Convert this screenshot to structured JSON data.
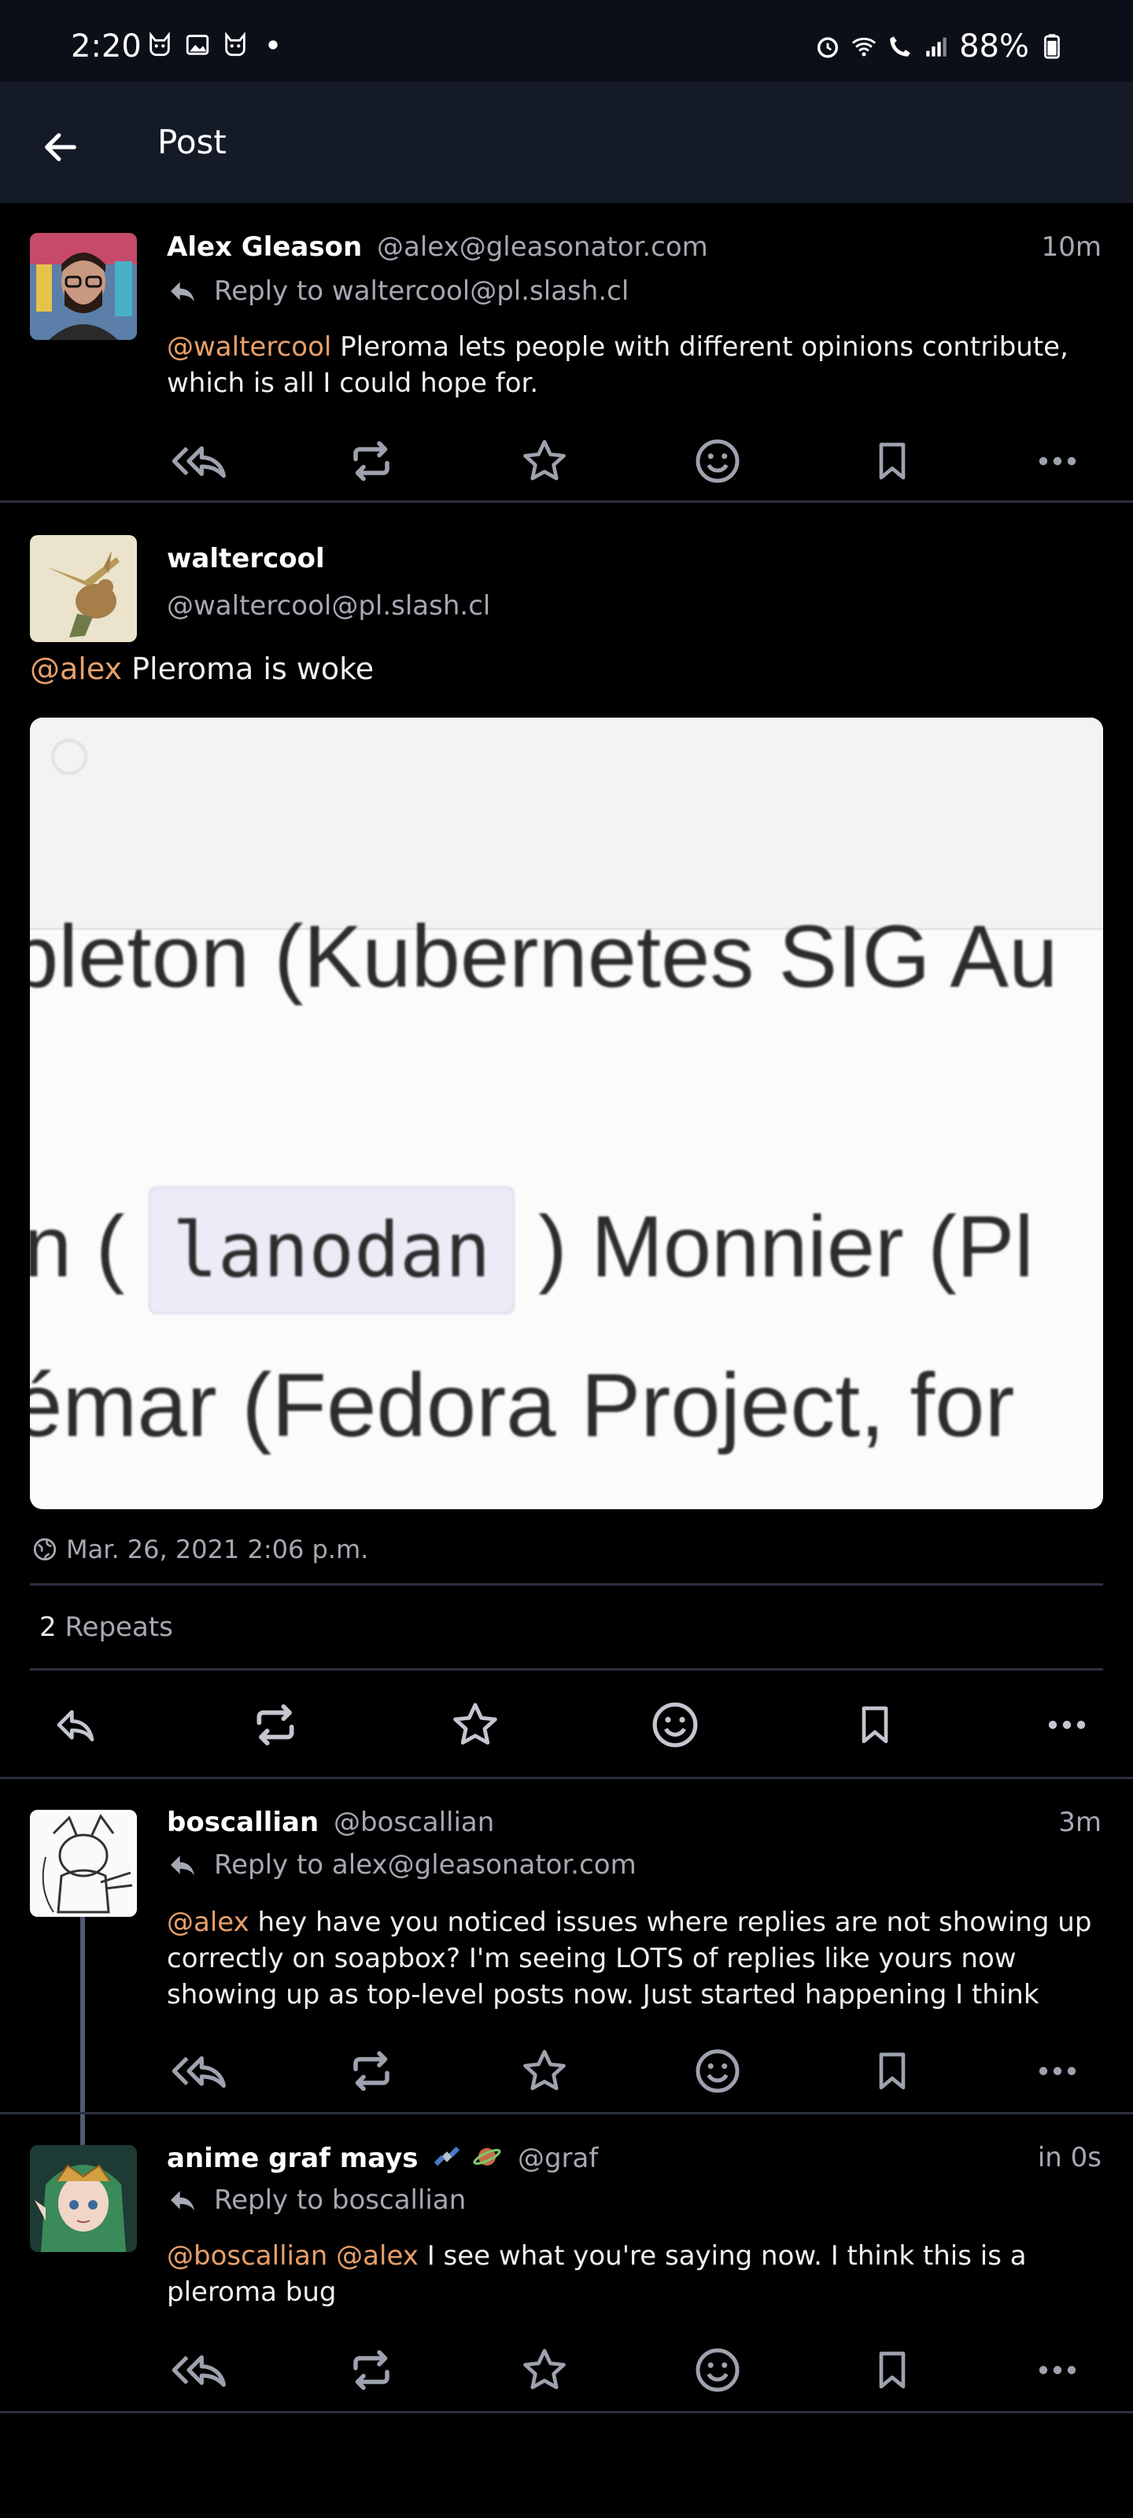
{
  "status_bar": {
    "time": "2:20",
    "battery": "88%"
  },
  "app_bar": {
    "title": "Post"
  },
  "post1": {
    "display_name": "Alex Gleason",
    "handle": "@alex@gleasonator.com",
    "time": "10m",
    "reply_to": "Reply to waltercool@pl.slash.cl",
    "mention": "@waltercool",
    "text": " Pleroma lets people with different opinions contribute, which is all I could hope for."
  },
  "main_post": {
    "display_name": "waltercool",
    "handle": "@waltercool@pl.slash.cl",
    "mention": "@alex",
    "text": " Pleroma is woke",
    "image_text": {
      "line1": "pleton (Kubernetes SIG Au",
      "line2_prefix": "n (",
      "line2_code": "lanodan",
      "line2_suffix": ") Monnier (Pl",
      "line3": "émar (Fedora Project, for"
    },
    "date": "Mar. 26, 2021 2:06 p.m.",
    "repeats_count": "2",
    "repeats_label": "Repeats"
  },
  "post3": {
    "display_name": "boscallian",
    "handle": "@boscallian",
    "time": "3m",
    "reply_to": "Reply to alex@gleasonator.com",
    "mention": "@alex",
    "text": " hey have you noticed issues where replies are not showing up correctly on soapbox? I'm seeing LOTS of replies like yours now showing up as top-level posts now. Just started happening I think"
  },
  "post4": {
    "display_name": "anime graf mays",
    "handle": "@graf",
    "time": "in 0s",
    "reply_to": "Reply to boscallian",
    "mention": "@boscallian @alex",
    "text": " I see what you're saying now. I think this is a pleroma bug"
  },
  "icons": {
    "reply": "reply-icon",
    "reply_all": "reply-all-icon",
    "repost": "repost-icon",
    "favourite": "star-icon",
    "emoji": "emoji-icon",
    "bookmark": "bookmark-icon",
    "more": "more-icon"
  },
  "colors": {
    "background": "#000000",
    "app_bar": "#151a27",
    "mention": "#e8a06a",
    "muted": "#a6a8b3"
  }
}
